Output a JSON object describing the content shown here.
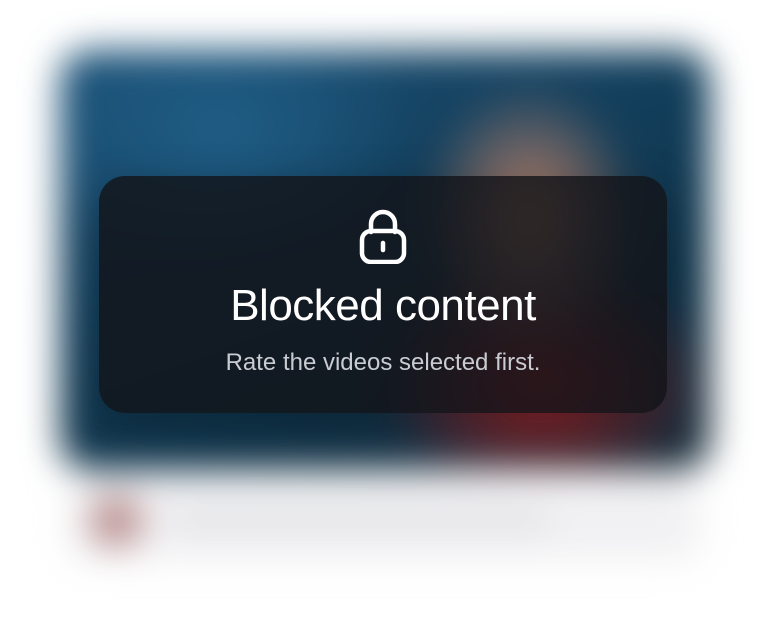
{
  "overlay": {
    "icon": "lock-icon",
    "title": "Blocked content",
    "subtitle": "Rate the videos selected first."
  },
  "colors": {
    "overlay_background": "#121418",
    "title_text": "#ffffff",
    "subtitle_text": "#c9ccd2"
  }
}
